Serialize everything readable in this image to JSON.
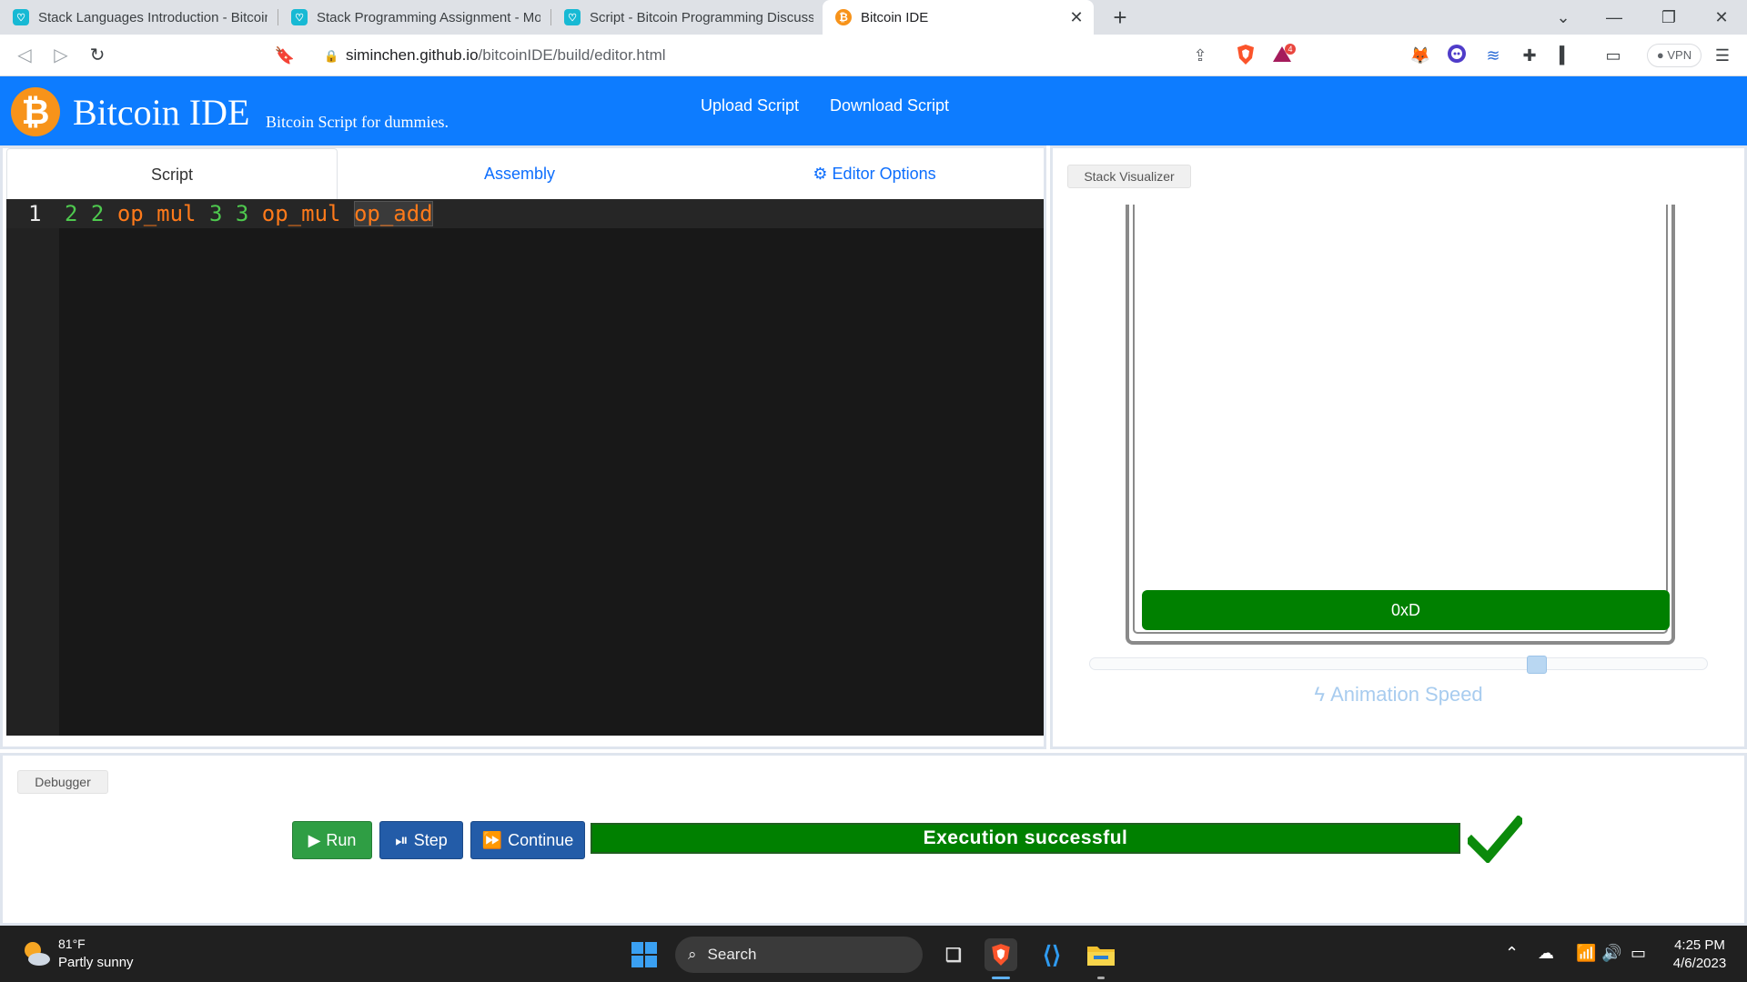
{
  "browser": {
    "tabs": [
      {
        "title": "Stack Languages Introduction - Bitcoin",
        "active": false
      },
      {
        "title": "Stack Programming Assignment - Mor",
        "active": false
      },
      {
        "title": "Script - Bitcoin Programming Discussi",
        "active": false
      },
      {
        "title": "Bitcoin IDE",
        "active": true
      }
    ],
    "close_glyph": "✕",
    "new_tab_glyph": "+",
    "url_host": "siminchen.github.io",
    "url_path": "/bitcoinIDE/build/editor.html",
    "vpn_label": "VPN",
    "notification_count": "4"
  },
  "app": {
    "logo_glyph": "₿",
    "name": "Bitcoin IDE",
    "tagline": "Bitcoin Script for dummies.",
    "nav": {
      "upload": "Upload Script",
      "download": "Download Script"
    },
    "brand_color": "#0d7cff"
  },
  "editor": {
    "tabs": {
      "script": "Script",
      "assembly": "Assembly",
      "options": "Editor Options"
    },
    "line_number": "1",
    "tokens": [
      {
        "text": "2",
        "kind": "num"
      },
      {
        "text": "2",
        "kind": "num"
      },
      {
        "text": "op_mul",
        "kind": "op"
      },
      {
        "text": "3",
        "kind": "num"
      },
      {
        "text": "3",
        "kind": "num"
      },
      {
        "text": "op_mul",
        "kind": "op"
      },
      {
        "text": "op_add",
        "kind": "op",
        "selected": true
      }
    ]
  },
  "stack": {
    "panel_label": "Stack Visualizer",
    "items": [
      "0xD"
    ],
    "animation_label": "Animation Speed",
    "animation_speed_fraction": 0.73
  },
  "debugger": {
    "panel_label": "Debugger",
    "run": "Run",
    "step": "Step",
    "continue": "Continue",
    "status": "Execution successful",
    "status_color": "#008000"
  },
  "taskbar": {
    "temperature": "81°F",
    "weather": "Partly sunny",
    "search": "Search",
    "time": "4:25 PM",
    "date": "4/6/2023"
  }
}
